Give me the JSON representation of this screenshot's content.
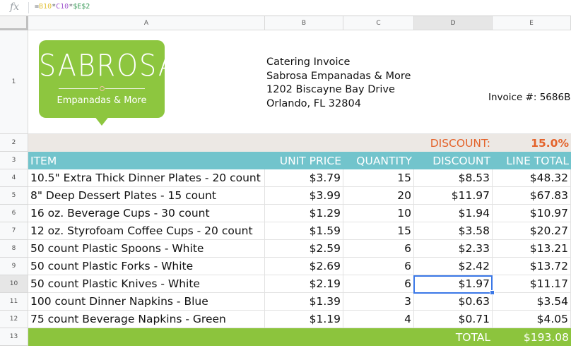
{
  "formula_bar": {
    "icon": "fx-icon",
    "prefix": "=",
    "ref1": "B10",
    "op1": "*",
    "ref2": "C10",
    "op2": "*",
    "ref3": "$E$2"
  },
  "columns": [
    "A",
    "B",
    "C",
    "D",
    "E"
  ],
  "rows": [
    "1",
    "2",
    "3",
    "4",
    "5",
    "6",
    "7",
    "8",
    "9",
    "10",
    "11",
    "12",
    "13"
  ],
  "logo": {
    "name": "SABROSA",
    "tagline": "Empanadas & More"
  },
  "address": {
    "line1": "Catering Invoice",
    "line2": "Sabrosa Empanadas & More",
    "line3": "1202 Biscayne Bay Drive",
    "line4": "Orlando, FL 32804"
  },
  "invoice": "Invoice #:  5686B",
  "discount": {
    "label": "DISCOUNT:",
    "value": "15.0%"
  },
  "headers": [
    "ITEM",
    "UNIT PRICE",
    "QUANTITY",
    "DISCOUNT",
    "LINE TOTAL"
  ],
  "items": [
    [
      "10.5\" Extra Thick Dinner Plates - 20 count",
      "$3.79",
      "15",
      "$8.53",
      "$48.32"
    ],
    [
      "8\" Deep Dessert Plates - 15 count",
      "$3.99",
      "20",
      "$11.97",
      "$67.83"
    ],
    [
      "16 oz. Beverage Cups - 30 count",
      "$1.29",
      "10",
      "$1.94",
      "$10.97"
    ],
    [
      "12 oz. Styrofoam Coffee Cups - 20 count",
      "$1.59",
      "15",
      "$3.58",
      "$20.27"
    ],
    [
      "50 count Plastic Spoons - White",
      "$2.59",
      "6",
      "$2.33",
      "$13.21"
    ],
    [
      "50 count Plastic Forks - White",
      "$2.69",
      "6",
      "$2.42",
      "$13.72"
    ],
    [
      "50 count Plastic Knives - White",
      "$2.19",
      "6",
      "$1.97",
      "$11.17"
    ],
    [
      "100 count Dinner Napkins - Blue",
      "$1.39",
      "3",
      "$0.63",
      "$3.54"
    ],
    [
      "75 count Beverage Napkins - Green",
      "$1.19",
      "4",
      "$0.71",
      "$4.05"
    ]
  ],
  "total": {
    "label": "TOTAL",
    "value": "$193.08"
  },
  "colors": {
    "header_bg": "#72c4cc",
    "discount_row_bg": "#ece8e4",
    "discount_text": "#e4632b",
    "total_bg": "#8cc43d",
    "logo_green": "#8dc63f",
    "selection": "#3b78e7"
  }
}
